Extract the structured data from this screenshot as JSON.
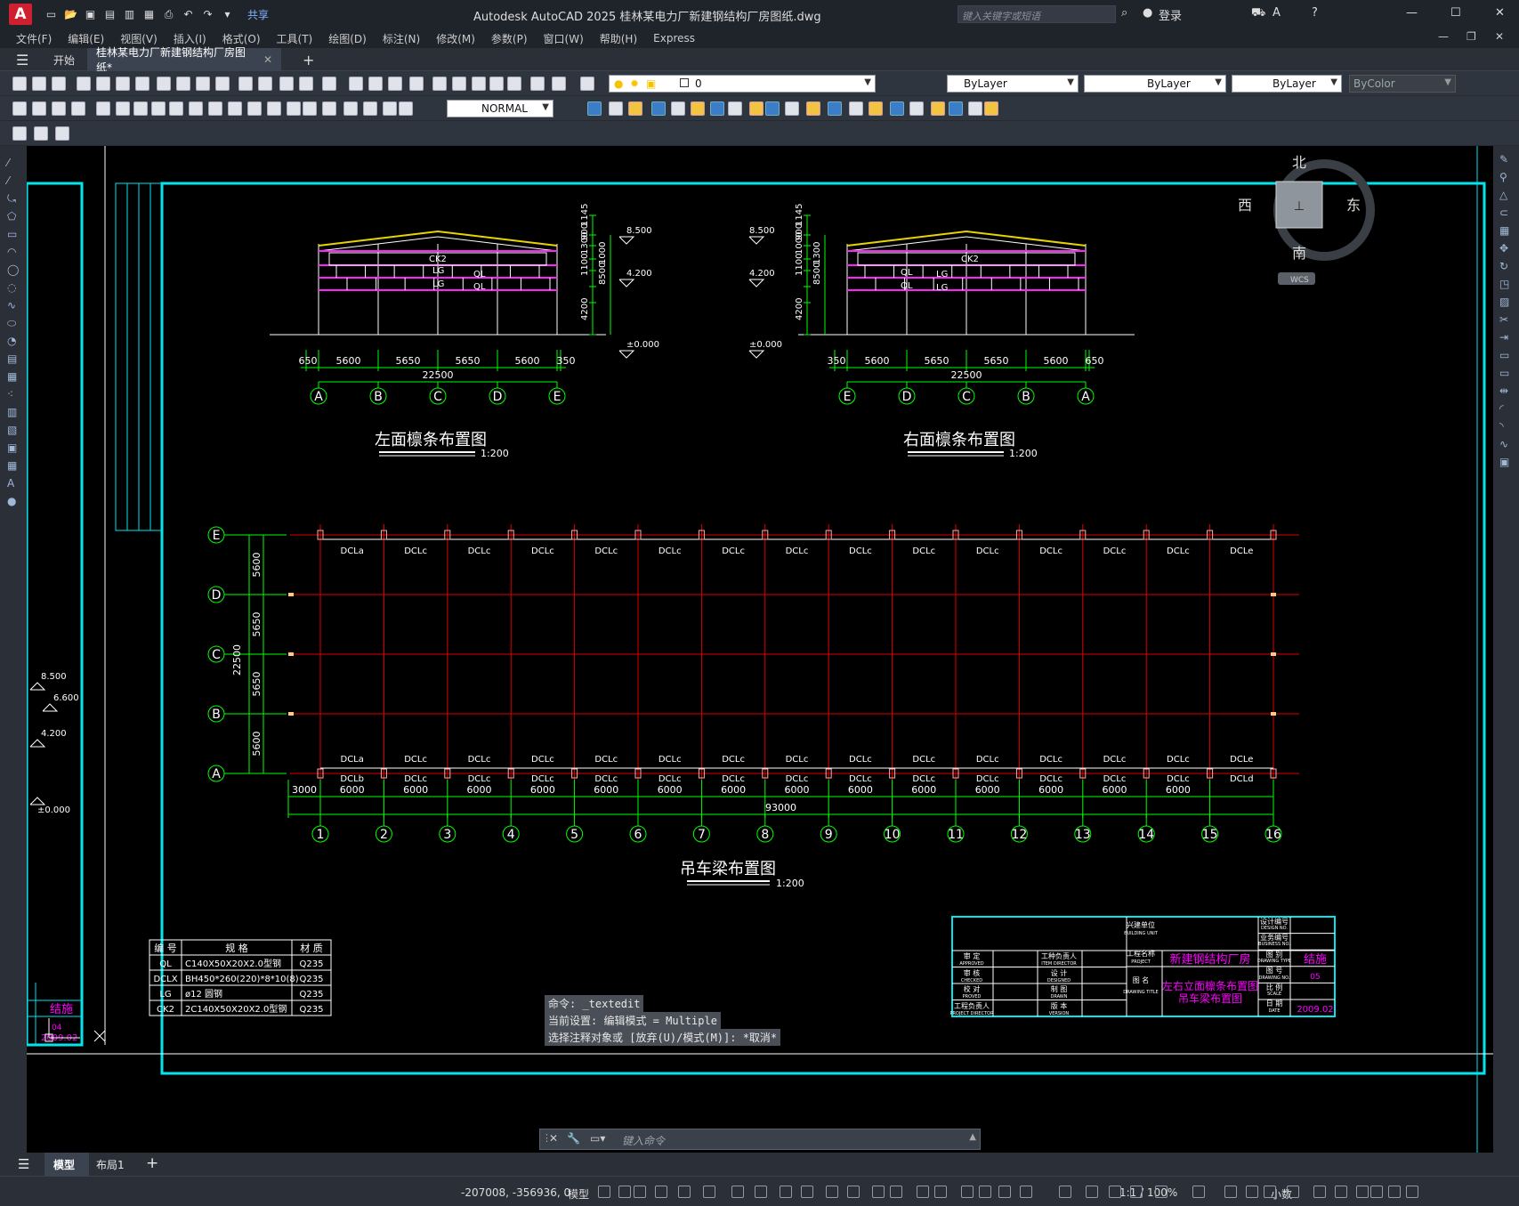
{
  "titlebar": {
    "logo": "A",
    "share": "共享",
    "title": "Autodesk AutoCAD 2025    桂林某电力厂新建钢结构厂房图纸.dwg",
    "search_placeholder": "键入关键字或短语",
    "login": "登录"
  },
  "menu": [
    "文件(F)",
    "编辑(E)",
    "视图(V)",
    "插入(I)",
    "格式(O)",
    "工具(T)",
    "绘图(D)",
    "标注(N)",
    "修改(M)",
    "参数(P)",
    "窗口(W)",
    "帮助(H)",
    "Express"
  ],
  "tabs": {
    "start": "开始",
    "doc": "桂林某电力厂新建钢结构厂房图纸*"
  },
  "toolbar": {
    "layer": "0",
    "color": "ByLayer",
    "linetype": "ByLayer",
    "lineweight": "ByLayer",
    "plotstyle": "ByColor",
    "dimstyle": "NORMAL"
  },
  "viewcube": {
    "north": "北",
    "south": "南",
    "east": "东",
    "west": "西",
    "wcs": "WCS"
  },
  "drawing": {
    "left_elev": {
      "title": "左面檩条布置图",
      "scale": "1:200",
      "spans": [
        "650",
        "5600",
        "5650",
        "5650",
        "5600",
        "350"
      ],
      "total": "22500",
      "axes": [
        "A",
        "B",
        "C",
        "D",
        "E"
      ],
      "labels": [
        "CK2",
        "LG",
        "QL",
        "LG",
        "QL"
      ],
      "elev_marks": [
        "8.500",
        "4.200",
        "±0.000"
      ],
      "heights": [
        "1145",
        "900",
        "1300",
        "1000",
        "1100",
        "8500",
        "4200"
      ]
    },
    "right_elev": {
      "title": "右面檩条布置图",
      "scale": "1:200",
      "spans": [
        "350",
        "5600",
        "5650",
        "5650",
        "5600",
        "650"
      ],
      "total": "22500",
      "axes": [
        "E",
        "D",
        "C",
        "B",
        "A"
      ],
      "labels": [
        "CK2",
        "QL",
        "LG",
        "QL",
        "LG"
      ],
      "elev_marks": [
        "8.500",
        "4.200",
        "±0.000"
      ],
      "heights": [
        "1145",
        "900",
        "1000",
        "1300",
        "1100",
        "8500",
        "4200"
      ]
    },
    "plan": {
      "title": "吊车梁布置图",
      "scale": "1:200",
      "row_axes": [
        "E",
        "D",
        "C",
        "B",
        "A"
      ],
      "row_spans": [
        "5600",
        "5650",
        "5650",
        "5600"
      ],
      "row_total": "22500",
      "col_axes": [
        "1",
        "2",
        "3",
        "4",
        "5",
        "6",
        "7",
        "8",
        "9",
        "10",
        "11",
        "12",
        "13",
        "14",
        "15",
        "16"
      ],
      "col_spans": [
        "3000",
        "6000",
        "6000",
        "6000",
        "6000",
        "6000",
        "6000",
        "6000",
        "6000",
        "6000",
        "6000",
        "6000",
        "6000",
        "6000",
        "6000"
      ],
      "col_total": "93000",
      "top_labels": [
        "DCLa",
        "DCLc",
        "DCLc",
        "DCLc",
        "DCLc",
        "DCLc",
        "DCLc",
        "DCLc",
        "DCLc",
        "DCLc",
        "DCLc",
        "DCLc",
        "DCLc",
        "DCLc",
        "DCLe"
      ],
      "bot_labels": [
        "DCLa",
        "DCLc",
        "DCLc",
        "DCLc",
        "DCLc",
        "DCLc",
        "DCLc",
        "DCLc",
        "DCLc",
        "DCLc",
        "DCLc",
        "DCLc",
        "DCLc",
        "DCLc",
        "DCLe"
      ],
      "bot_labels2": [
        "DCLb",
        "DCLc",
        "DCLc",
        "DCLc",
        "DCLc",
        "DCLc",
        "DCLc",
        "DCLc",
        "DCLc",
        "DCLc",
        "DCLc",
        "DCLc",
        "DCLc",
        "DCLc",
        "DCLd"
      ]
    },
    "side_elev": [
      "8.500",
      "6.600",
      "4.200",
      "±0.000"
    ],
    "member_table": {
      "headers": [
        "编 号",
        "规 格",
        "材 质"
      ],
      "rows": [
        [
          "QL",
          "C140X50X20X2.0型钢",
          "Q235"
        ],
        [
          "DCLX",
          "BH450*260(220)*8*10(8)",
          "Q235"
        ],
        [
          "LG",
          "ø12 圆钢",
          "Q235"
        ],
        [
          "CK2",
          "2C140X50X20X2.0型钢",
          "Q235"
        ]
      ]
    },
    "title_block": {
      "project": "新建钢结构厂房",
      "drawing_name1": "左右立面檩条布置图",
      "drawing_name2": "吊车梁布置图",
      "type": "结施",
      "no": "05",
      "date": "2009.02",
      "left_type": "结施",
      "left_no": "04",
      "left_date": "2009.02",
      "cells": [
        "兴建单位",
        "BUILDING UNIT",
        "工程名称",
        "PROJECT",
        "审 定",
        "APPROVED",
        "工种负责人",
        "ITEM DIRECTOR",
        "审 核",
        "CHECKED",
        "设 计",
        "DESIGNED",
        "校 对",
        "PROVED",
        "制 图",
        "DRAWN",
        "工程负责人",
        "PROJECT DIRECTOR",
        "版 本",
        "VERSION",
        "图 名",
        "DRAWING TITLE",
        "设计编号",
        "DESIGN NO.",
        "业务编号",
        "BUSINESS NO.",
        "图 别",
        "DRAWING TYPE",
        "图 号",
        "DRAWING NO.",
        "比 例",
        "SCALE",
        "日 期",
        "DATE"
      ]
    }
  },
  "command": {
    "line1": "命令: _textedit",
    "line2": "当前设置: 编辑模式 = Multiple",
    "line3": "选择注释对象或 [放弃(U)/模式(M)]: *取消*",
    "placeholder": "键入命令"
  },
  "layout_tabs": [
    "模型",
    "布局1"
  ],
  "status": {
    "coords": "-207008, -356936, 0",
    "model": "模型",
    "scale": "1:1 / 100%",
    "units": "小数"
  }
}
